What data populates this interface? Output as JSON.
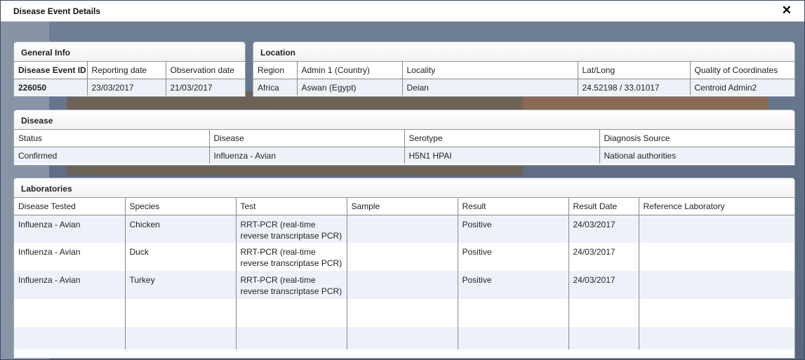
{
  "window": {
    "title": "Disease Event Details"
  },
  "general_info": {
    "header": "General Info",
    "columns": [
      "Disease Event ID",
      "Reporting date",
      "Observation date"
    ],
    "row": [
      "226050",
      "23/03/2017",
      "21/03/2017"
    ]
  },
  "location": {
    "header": "Location",
    "columns": [
      "Region",
      "Admin 1 (Country)",
      "Locality",
      "Lat/Long",
      "Quality of Coordinates"
    ],
    "row": [
      "Africa",
      "Aswan (Egypt)",
      "Deian",
      "24.52198 / 33.01017",
      "Centroid Admin2"
    ]
  },
  "disease": {
    "header": "Disease",
    "columns": [
      "Status",
      "Disease",
      "Serotype",
      "Diagnosis Source"
    ],
    "row": [
      "Confirmed",
      "Influenza - Avian",
      "H5N1 HPAI",
      "National authorities"
    ]
  },
  "laboratories": {
    "header": "Laboratories",
    "columns": [
      "Disease Tested",
      "Species",
      "Test",
      "Sample",
      "Result",
      "Result Date",
      "Reference Laboratory"
    ],
    "rows": [
      [
        "Influenza - Avian",
        "Chicken",
        "RRT-PCR (real-time reverse transcriptase PCR)",
        "",
        "Positive",
        "24/03/2017",
        ""
      ],
      [
        "Influenza - Avian",
        "Duck",
        "RRT-PCR (real-time reverse transcriptase PCR)",
        "",
        "Positive",
        "24/03/2017",
        ""
      ],
      [
        "Influenza - Avian",
        "Turkey",
        "RRT-PCR (real-time reverse transcriptase PCR)",
        "",
        "Positive",
        "24/03/2017",
        ""
      ],
      [
        "",
        "",
        "",
        "",
        "",
        "",
        ""
      ],
      [
        "",
        "",
        "",
        "",
        "",
        "",
        ""
      ]
    ]
  }
}
